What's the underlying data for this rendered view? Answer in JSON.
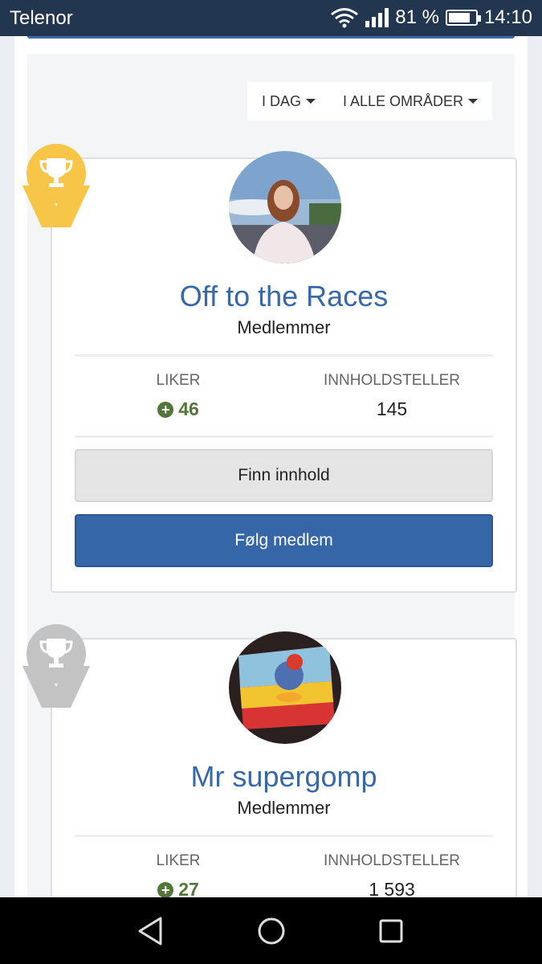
{
  "statusbar": {
    "carrier": "Telenor",
    "battery": "81 %",
    "battery_level": 0.81,
    "time": "14:10"
  },
  "filters": {
    "period": "I DAG",
    "area": "I ALLE OMRÅDER"
  },
  "members": [
    {
      "name": "Off to the Races",
      "group": "Medlemmer",
      "likes_label": "LIKER",
      "likes": "46",
      "content_label": "INNHOLDSTELLER",
      "content": "145",
      "find_label": "Finn innhold",
      "follow_label": "Følg medlem",
      "rank": "gold",
      "ribbon_color": "#f7c548"
    },
    {
      "name": "Mr supergomp",
      "group": "Medlemmer",
      "likes_label": "LIKER",
      "likes": "27",
      "content_label": "INNHOLDSTELLER",
      "content": "1 593",
      "rank": "silver",
      "ribbon_color": "#c3c3c3"
    }
  ],
  "colors": {
    "accent": "#3566a8",
    "name_link": "#3868a8",
    "likes_green": "#53763a",
    "statusbar_bg": "#22364f"
  },
  "icons": {
    "trophy": "trophy-icon",
    "plus": "plus-circle-icon",
    "nav_back": "back-triangle-icon",
    "nav_home": "home-circle-icon",
    "nav_recent": "recent-square-icon"
  }
}
